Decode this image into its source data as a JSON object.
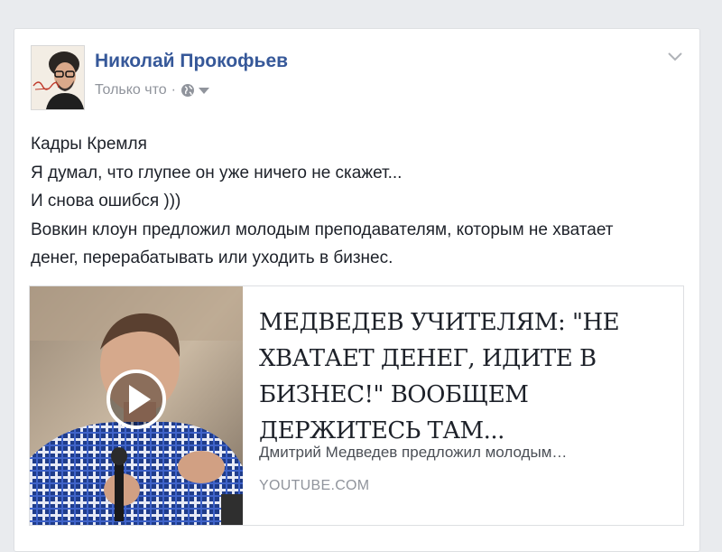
{
  "post": {
    "author_name": "Николай Прокофьев",
    "timestamp": "Только что",
    "privacy_icon": "globe-icon",
    "audience_dropdown_icon": "caret-down-icon",
    "options_icon": "chevron-down-icon",
    "text_lines": [
      "Кадры Кремля",
      "Я думал, что глупее он уже ничего не скажет...",
      "И снова ошибся )))",
      "Вовкин клоун предложил молодым преподавателям, которым не хватает",
      "денег, перерабатывать или уходить в бизнес."
    ]
  },
  "link_preview": {
    "headline": "МЕДВЕДЕВ УЧИТЕЛЯМ: \"НЕ ХВАТАЕТ ДЕНЕГ, ИДИТЕ В БИЗНЕС!\" ВООБЩЕМ ДЕРЖИТЕСЬ ТАМ...",
    "description": "Дмитрий Медведев предложил молодым…",
    "domain": "YOUTUBE.COM",
    "play_icon": "play-icon"
  },
  "colors": {
    "author_link": "#365899",
    "meta_text": "#90949c",
    "page_background": "#e9ebee"
  }
}
